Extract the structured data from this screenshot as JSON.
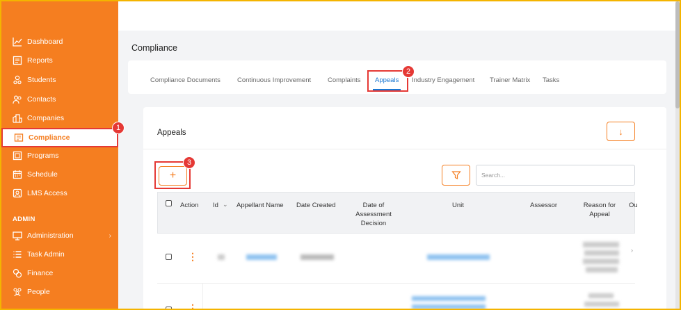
{
  "sidebar": {
    "items": [
      {
        "label": "Dashboard",
        "icon": "chart-line-icon"
      },
      {
        "label": "Reports",
        "icon": "report-icon"
      },
      {
        "label": "Students",
        "icon": "students-icon"
      },
      {
        "label": "Contacts",
        "icon": "contacts-icon"
      },
      {
        "label": "Companies",
        "icon": "companies-icon"
      },
      {
        "label": "Compliance",
        "icon": "compliance-icon",
        "active": true
      },
      {
        "label": "Programs",
        "icon": "programs-icon"
      },
      {
        "label": "Schedule",
        "icon": "calendar-icon"
      },
      {
        "label": "LMS Access",
        "icon": "lms-icon"
      }
    ],
    "admin_section": "ADMIN",
    "admin_items": [
      {
        "label": "Administration",
        "icon": "monitor-icon"
      },
      {
        "label": "Task Admin",
        "icon": "list-icon"
      },
      {
        "label": "Finance",
        "icon": "finance-icon"
      },
      {
        "label": "People",
        "icon": "people-icon"
      }
    ]
  },
  "page": {
    "title": "Compliance"
  },
  "tabs": [
    "Compliance Documents",
    "Continuous Improvement",
    "Complaints",
    "Appeals",
    "Industry Engagement",
    "Trainer Matrix",
    "Tasks"
  ],
  "active_tab": "Appeals",
  "card": {
    "title": "Appeals",
    "download_icon": "↓",
    "add_icon": "+",
    "search_placeholder": "Search..."
  },
  "table": {
    "headers": {
      "action": "Action",
      "id": "Id",
      "appellant": "Appellant Name",
      "created": "Date Created",
      "decision": "Date of Assessment Decision",
      "unit": "Unit",
      "assessor": "Assessor",
      "reason": "Reason for Appeal",
      "outcome": "Ou"
    },
    "kebab": "⋮"
  },
  "callouts": [
    "1",
    "2",
    "3"
  ],
  "colors": {
    "accent": "#f57e20",
    "highlight": "#e53935",
    "link": "#1976d2"
  }
}
